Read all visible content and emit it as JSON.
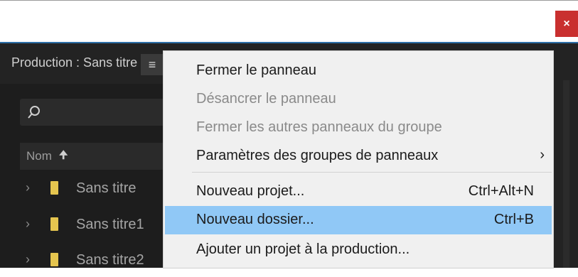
{
  "window": {
    "close_label": "×"
  },
  "panel": {
    "title": "Production : Sans titre",
    "menu_icon": "≡",
    "search": {
      "icon": "search-icon",
      "value": ""
    },
    "column_header": {
      "label": "Nom",
      "sort_arrow": "🠉"
    },
    "rows": [
      {
        "expand": "›",
        "icon": "folder-icon",
        "name": "Sans titre"
      },
      {
        "expand": "›",
        "icon": "folder-icon",
        "name": "Sans titre1"
      },
      {
        "expand": "›",
        "icon": "folder-icon",
        "name": "Sans titre2"
      }
    ]
  },
  "menu": {
    "items": [
      {
        "label": "Fermer le panneau",
        "enabled": true
      },
      {
        "label": "Désancrer le panneau",
        "enabled": false
      },
      {
        "label": "Fermer les autres panneaux du groupe",
        "enabled": false
      },
      {
        "label": "Paramètres des groupes de panneaux",
        "enabled": true,
        "submenu": "›"
      },
      {
        "label": "Nouveau projet...",
        "shortcut": "Ctrl+Alt+N",
        "enabled": true
      },
      {
        "label": "Nouveau dossier...",
        "shortcut": "Ctrl+B",
        "enabled": true,
        "highlighted": true
      },
      {
        "label": "Ajouter un projet à la production...",
        "enabled": true
      }
    ]
  },
  "colors": {
    "highlight": "#90c8f6",
    "close_button": "#c9302f",
    "folder": "#e5c54f",
    "panel_bg": "#1d1d1d"
  }
}
